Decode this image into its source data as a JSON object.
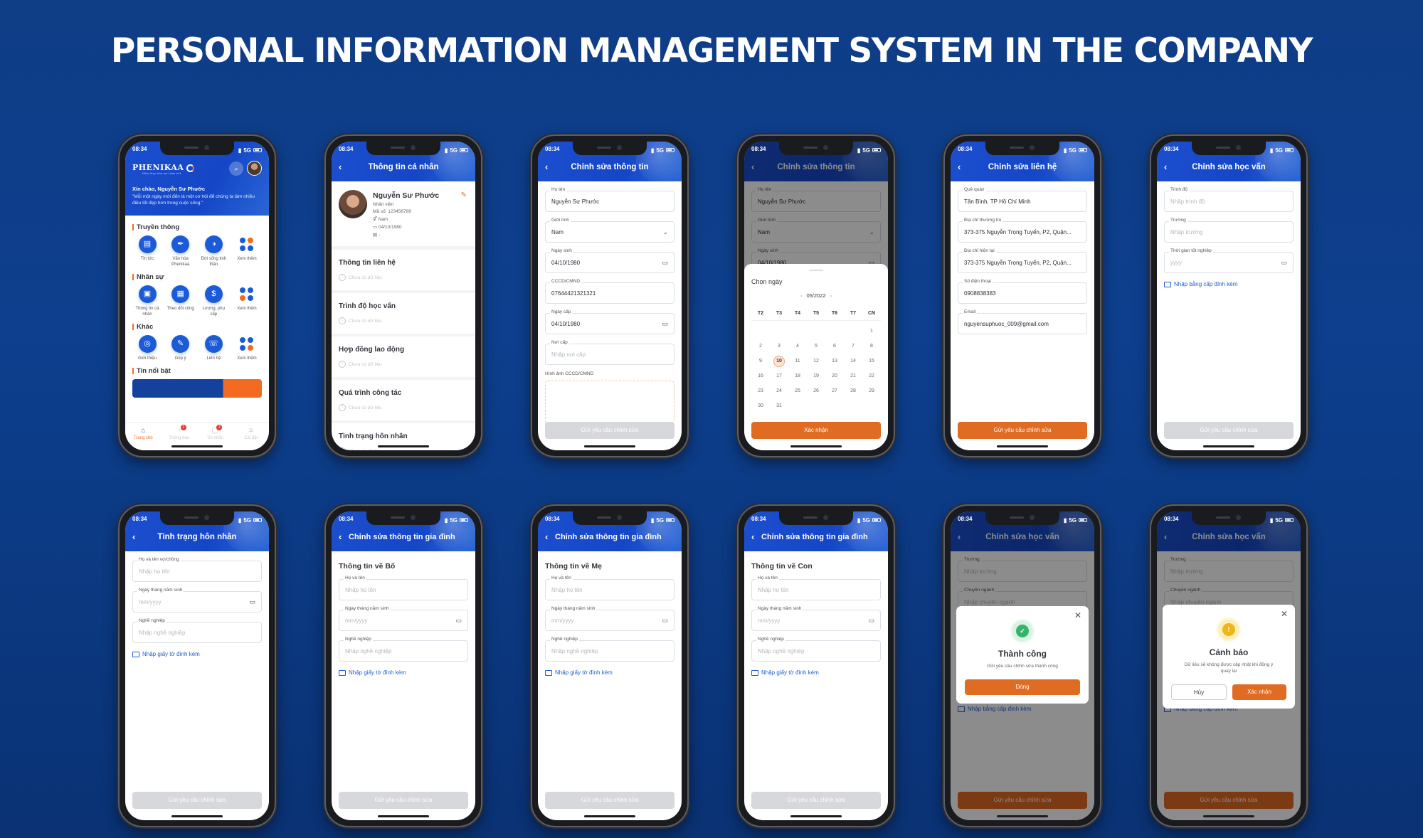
{
  "page_title": "PERSONAL INFORMATION MANAGEMENT SYSTEM IN THE COMPANY",
  "status_bar": {
    "time": "08:34",
    "network": "5G"
  },
  "common": {
    "submit_label": "Gửi yêu cầu chỉnh sửa",
    "back_glyph": "‹",
    "calendar_glyph": "▭",
    "chevron_glyph": "⌄"
  },
  "home": {
    "brand": "PHENIKAA",
    "tagline": "Hiện thực hóa mọi cam kết",
    "greeting": "Xin chào, Nguyễn Sư Phước",
    "quote": "\"Mỗi một ngày mới đến là một cơ hội để chúng ta làm nhiều điều tốt đẹp hơn trong cuộc sống.\"",
    "sections": [
      {
        "title": "Truyền thông",
        "items": [
          "Tin tức",
          "Văn hóa Phenikaa",
          "Đời sống tinh thần",
          "Xem thêm"
        ]
      },
      {
        "title": "Nhân sự",
        "items": [
          "Thông tin cá nhân",
          "Theo dõi công",
          "Lương, phụ cấp",
          "Xem thêm"
        ]
      },
      {
        "title": "Khác",
        "items": [
          "Giới thiệu",
          "Góp ý",
          "Liên hệ",
          "Xem thêm"
        ]
      }
    ],
    "featured_title": "Tin nổi bật",
    "tabs": [
      {
        "label": "Trang chủ",
        "icon": "⌂",
        "active": true
      },
      {
        "label": "Thông báo",
        "icon": "◔",
        "badge": "2"
      },
      {
        "label": "Tin nhắn",
        "icon": "▢",
        "badge": "2"
      },
      {
        "label": "Cài đặt",
        "icon": "≡"
      }
    ]
  },
  "profile": {
    "header": "Thông tin cá nhân",
    "name": "Nguyễn Sư Phước",
    "role": "Nhân viên",
    "employee_id": "Mã số: 123456789",
    "gender": "Nam",
    "dob": "04/10/1980",
    "id_card": "-",
    "no_data": "Chưa có dữ liệu",
    "sections": [
      "Thông tin liên hệ",
      "Trình độ học vấn",
      "Hợp đồng lao động",
      "Quá trình công tác",
      "Tình trạng hôn nhân"
    ]
  },
  "edit_info": {
    "header": "Chỉnh sửa thông tin",
    "fields": [
      {
        "label": "Họ tên",
        "value": "Nguyễn Sư Phước"
      },
      {
        "label": "Giới tính",
        "value": "Nam"
      },
      {
        "label": "Ngày sinh",
        "value": "04/10/1980"
      },
      {
        "label": "CCCD/CMND",
        "value": "07644421321321"
      },
      {
        "label": "Ngày cấp",
        "value": "04/10/1980"
      },
      {
        "label": "Nơi cấp",
        "placeholder": "Nhập nơi cấp"
      }
    ],
    "image_label": "Hình ảnh CCCD/CMND"
  },
  "date_picker": {
    "title": "Chọn ngày",
    "month": "05/2022",
    "weekdays": [
      "T2",
      "T3",
      "T4",
      "T5",
      "T6",
      "T7",
      "CN"
    ],
    "weeks": [
      [
        "",
        "",
        "",
        "",
        "",
        "",
        "1"
      ],
      [
        "2",
        "3",
        "4",
        "5",
        "6",
        "7",
        "8"
      ],
      [
        "9",
        "10",
        "11",
        "12",
        "13",
        "14",
        "15"
      ],
      [
        "16",
        "17",
        "18",
        "19",
        "20",
        "21",
        "22"
      ],
      [
        "23",
        "24",
        "25",
        "26",
        "27",
        "28",
        "29"
      ],
      [
        "30",
        "31",
        "",
        "",
        "",
        "",
        ""
      ]
    ],
    "selected": "10",
    "confirm_label": "Xác nhận"
  },
  "edit_contact": {
    "header": "Chỉnh sửa liên hệ",
    "fields": [
      {
        "label": "Quê quán",
        "value": "Tân Bình, TP Hồ Chí Minh"
      },
      {
        "label": "Địa chỉ thường trú",
        "value": "373-375 Nguyễn Trọng Tuyển, P2, Quận..."
      },
      {
        "label": "Địa chỉ hiện tại",
        "value": "373-375 Nguyễn Trọng Tuyển, P2, Quận..."
      },
      {
        "label": "Số điện thoại",
        "value": "0908838383"
      },
      {
        "label": "Email",
        "value": "nguyensuphuoc_009@gmail.com"
      }
    ]
  },
  "edit_education": {
    "header": "Chỉnh sửa học vấn",
    "fields": [
      {
        "label": "Trình độ",
        "placeholder": "Nhập trình độ"
      },
      {
        "label": "Trường",
        "placeholder": "Nhập trường"
      },
      {
        "label": "Thời gian tốt nghiệp",
        "placeholder": "yyyy"
      }
    ],
    "attach_label": "Nhập bằng cấp đính kèm",
    "bg_fields": [
      {
        "label": "Trường",
        "placeholder": "Nhập trường"
      },
      {
        "label": "Chuyên ngành",
        "placeholder": "Nhập chuyên ngành"
      }
    ]
  },
  "marital": {
    "header": "Tình trạng hôn nhân",
    "fields": [
      {
        "label": "Họ và tên vợ/chồng",
        "placeholder": "Nhập họ tên"
      },
      {
        "label": "Ngày tháng năm sinh",
        "placeholder": "mm/yyyy"
      },
      {
        "label": "Nghề nghiệp",
        "placeholder": "Nhập nghề nghiệp"
      }
    ],
    "attach_label": "Nhập giấy tờ đính kèm"
  },
  "family": {
    "header": "Chỉnh sửa thông tin gia đình",
    "sections": [
      "Thông tin về Bố",
      "Thông tin về Mẹ",
      "Thông tin về Con"
    ],
    "fields": [
      {
        "label": "Họ và tên",
        "placeholder": "Nhập họ tên"
      },
      {
        "label": "Ngày tháng năm sinh",
        "placeholder": "mm/yyyy"
      },
      {
        "label": "Nghề nghiệp",
        "placeholder": "Nhập nghề nghiệp"
      }
    ],
    "attach_label": "Nhập giấy tờ đính kèm"
  },
  "success_dialog": {
    "title": "Thành công",
    "message": "Gửi yêu cầu chỉnh sửa thành công",
    "button": "Đóng"
  },
  "warning_dialog": {
    "title": "Cảnh báo",
    "message": "Dữ liệu sẽ không được cập nhật khi đồng ý quay lại",
    "cancel": "Hủy",
    "confirm": "Xác nhận"
  }
}
